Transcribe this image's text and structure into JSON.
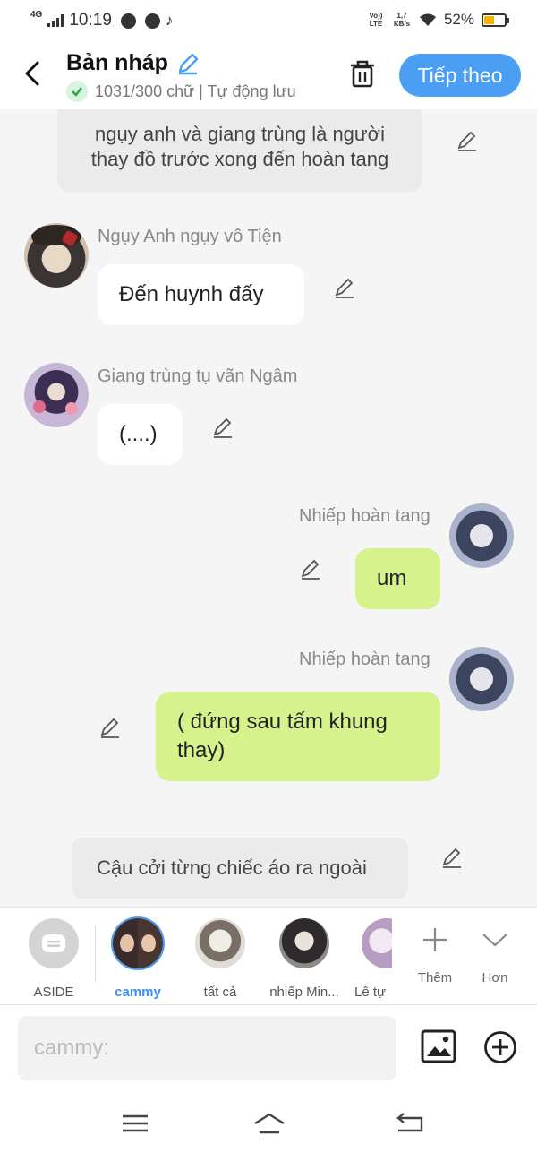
{
  "status": {
    "net": "4G",
    "time": "10:19",
    "volte": "Vo)) LTE",
    "speed": "1,7 KB/s",
    "battery": "52%",
    "battery_level": 0.52
  },
  "header": {
    "title": "Bản nháp",
    "subtitle": "1031/300 chữ | Tự động lưu",
    "next_label": "Tiếp theo"
  },
  "messages": [
    {
      "kind": "narration",
      "text": "ngụy anh và giang trùng là người thay đồ trước xong đến hoàn tang"
    },
    {
      "kind": "left",
      "name": "Ngụy Anh ngụy vô Tiện",
      "text": "Đến huynh đấy"
    },
    {
      "kind": "left",
      "name": "Giang trùng tụ vãn Ngâm",
      "text": "(....)"
    },
    {
      "kind": "right",
      "name": "Nhiếp hoàn tang",
      "text": "um"
    },
    {
      "kind": "right",
      "name": "Nhiếp hoàn tang",
      "text": "( đứng sau tấm khung thay)"
    },
    {
      "kind": "narration",
      "text": "Cậu cởi từng chiếc áo ra ngoài"
    }
  ],
  "characters": [
    {
      "label": "ASIDE"
    },
    {
      "label": "cammy"
    },
    {
      "label": "tất cả"
    },
    {
      "label": "nhiếp Min..."
    },
    {
      "label": "Lê tự"
    }
  ],
  "tools": {
    "add": "Thêm",
    "more": "Hơn"
  },
  "input": {
    "placeholder": "cammy:"
  },
  "colors": {
    "accent": "#4a9ff5",
    "right_bubble": "#d6f28c"
  }
}
